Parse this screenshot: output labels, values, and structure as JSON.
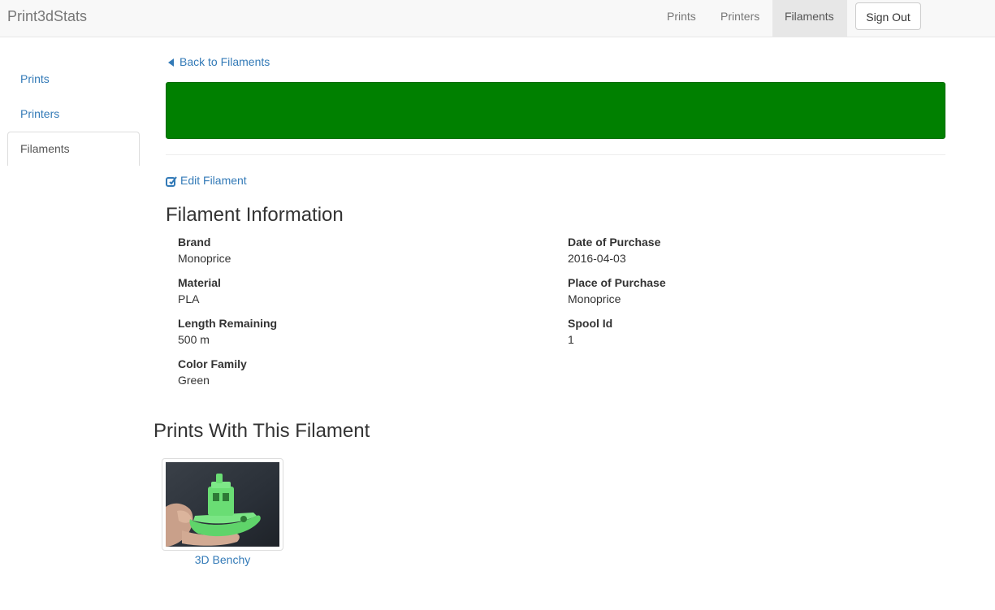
{
  "navbar": {
    "brand": "Print3dStats",
    "links": [
      {
        "label": "Prints",
        "active": false
      },
      {
        "label": "Printers",
        "active": false
      },
      {
        "label": "Filaments",
        "active": true
      }
    ],
    "signout_label": "Sign Out"
  },
  "sidebar": {
    "items": [
      {
        "label": "Prints",
        "active": false
      },
      {
        "label": "Printers",
        "active": false
      },
      {
        "label": "Filaments",
        "active": true
      }
    ]
  },
  "main": {
    "back_label": "Back to Filaments",
    "filament_color": "#008000",
    "edit_label": "Edit Filament",
    "info_heading": "Filament Information",
    "fields_left": [
      {
        "label": "Brand",
        "value": "Monoprice"
      },
      {
        "label": "Material",
        "value": "PLA"
      },
      {
        "label": "Length Remaining",
        "value": "500 m"
      },
      {
        "label": "Color Family",
        "value": "Green"
      }
    ],
    "fields_right": [
      {
        "label": "Date of Purchase",
        "value": "2016-04-03"
      },
      {
        "label": "Place of Purchase",
        "value": "Monoprice"
      },
      {
        "label": "Spool Id",
        "value": "1"
      }
    ],
    "prints_heading": "Prints With This Filament",
    "prints": [
      {
        "name": "3D Benchy"
      }
    ]
  },
  "colors": {
    "link": "#337ab7",
    "navbar_bg": "#f8f8f8",
    "swatch": "#008000"
  }
}
